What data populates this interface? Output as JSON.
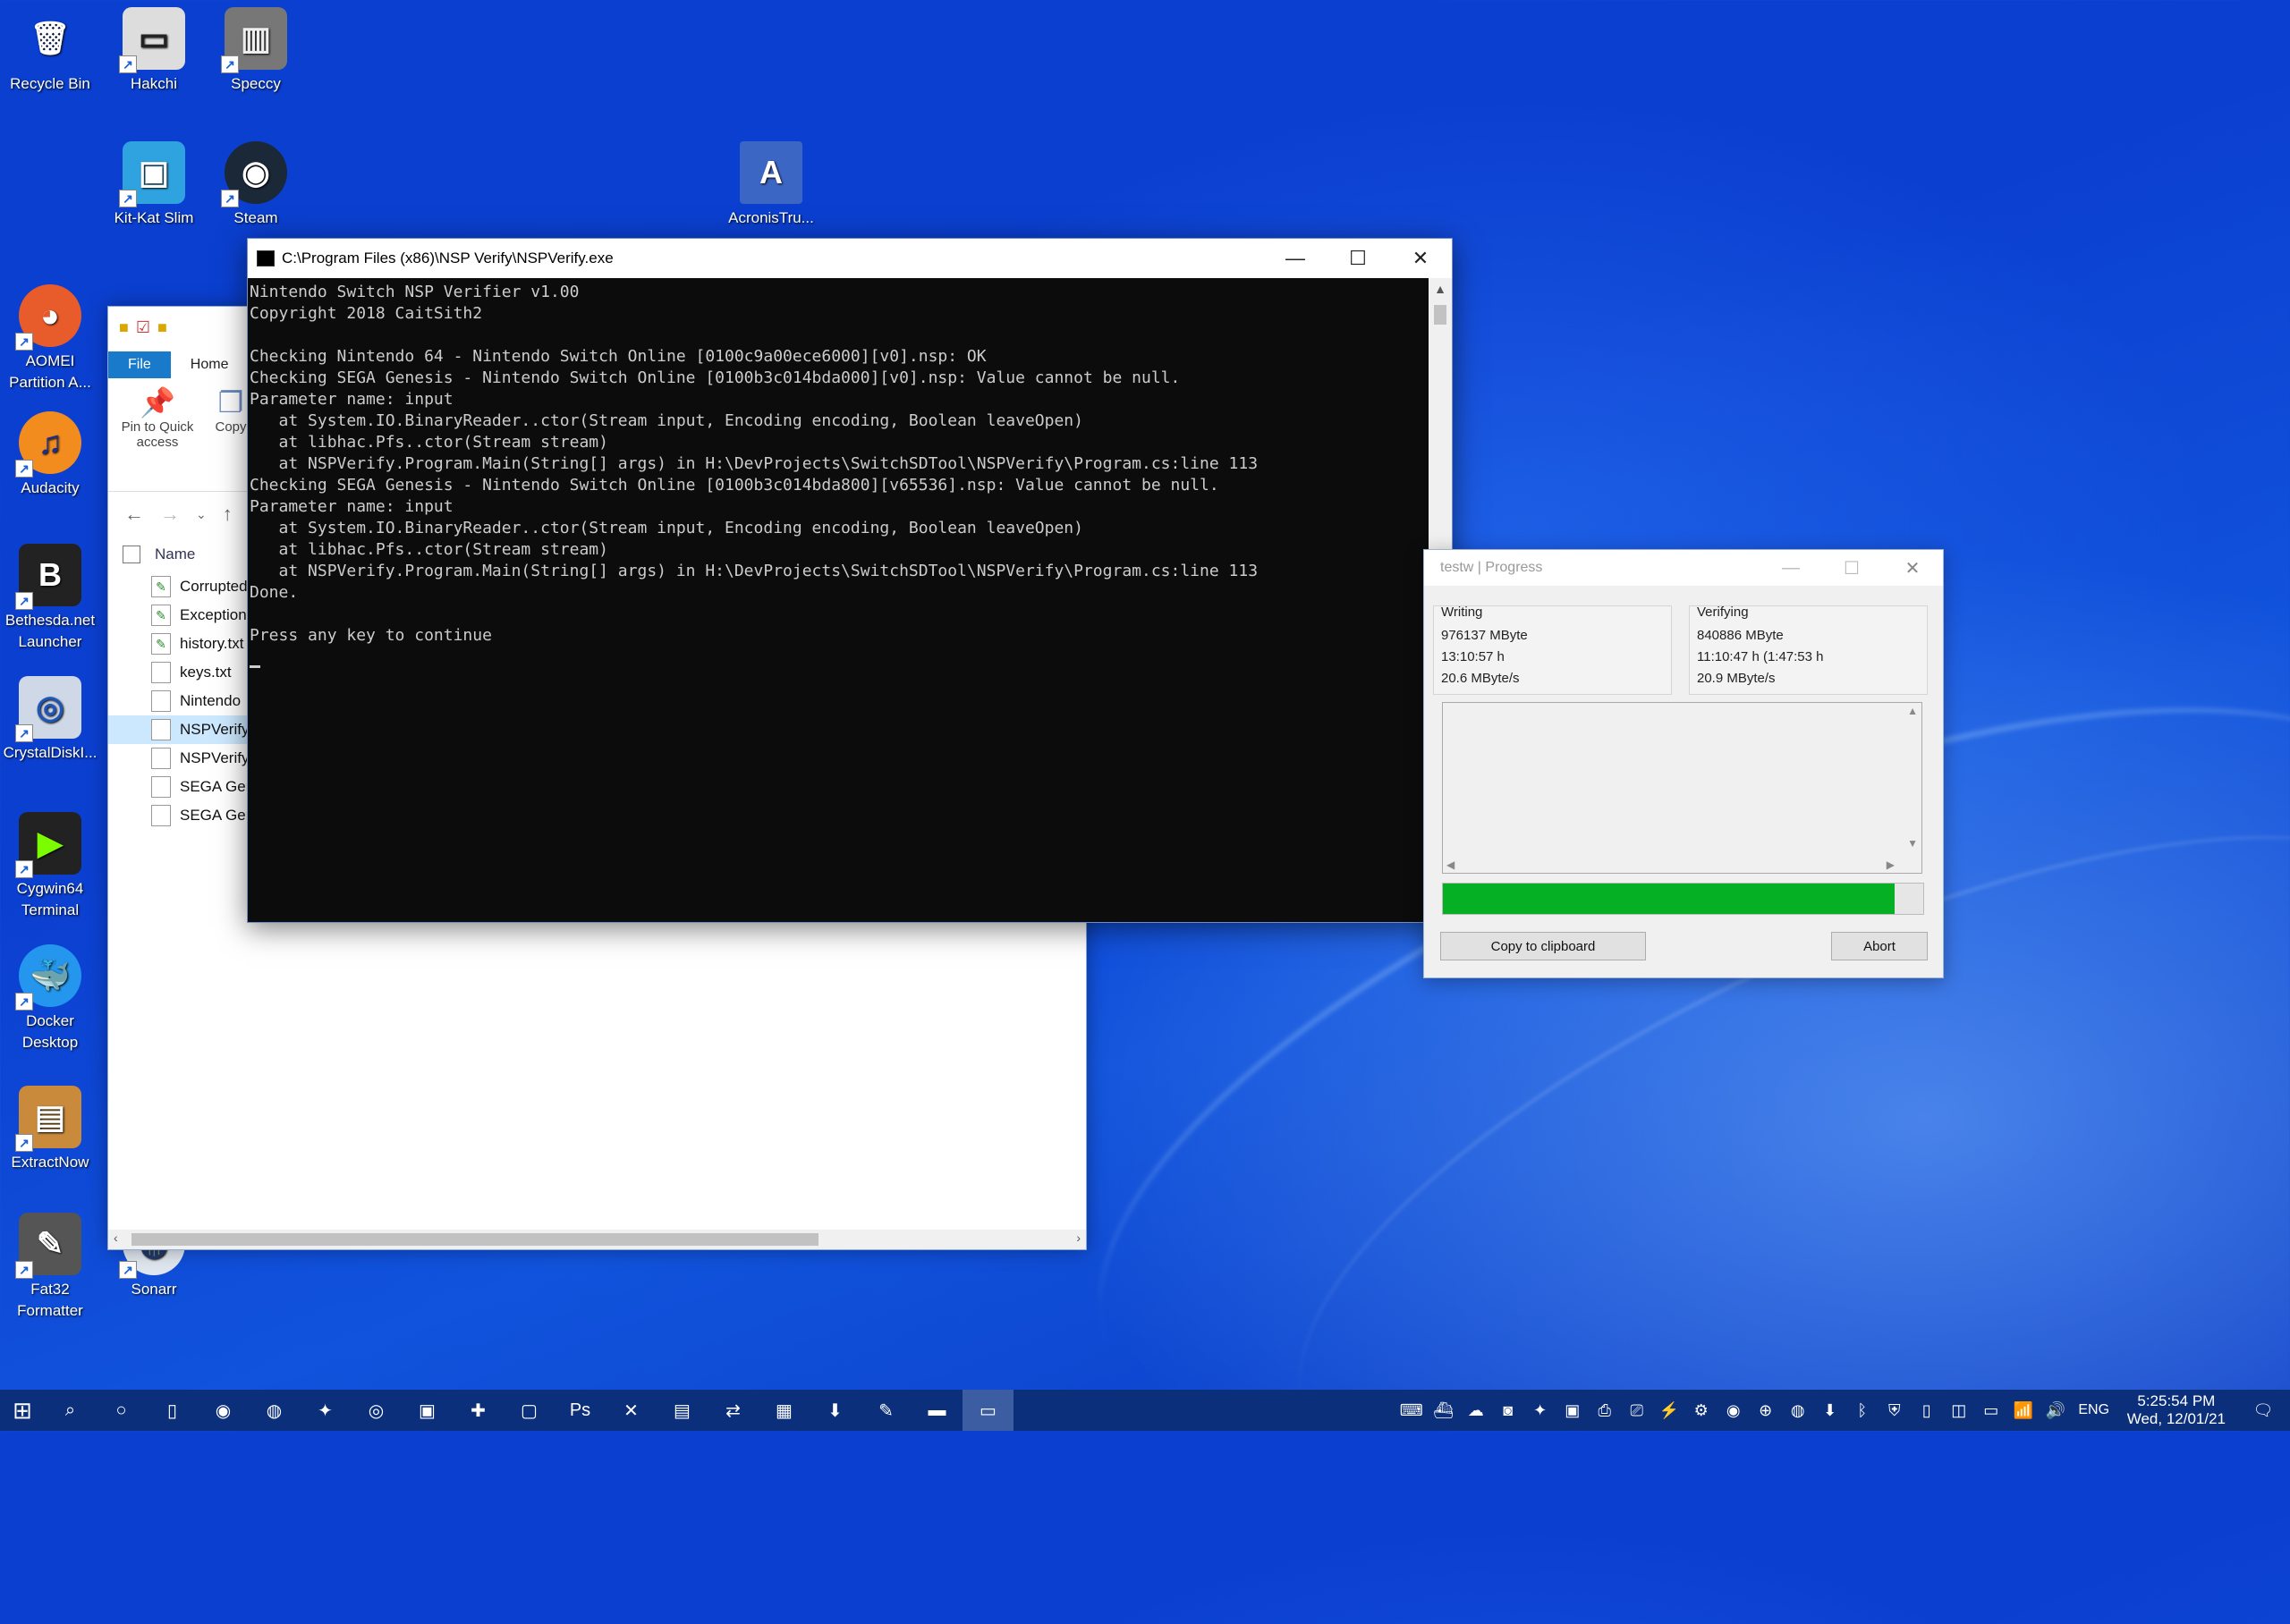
{
  "desktop": {
    "icons": [
      {
        "label": "Recycle Bin",
        "glyph": "🗑"
      },
      {
        "label": "Hakchi",
        "glyph": "▭"
      },
      {
        "label": "Speccy",
        "glyph": "▥"
      },
      {
        "label": "Kit-Kat Slim",
        "glyph": "▣"
      },
      {
        "label": "Steam",
        "glyph": "◉"
      },
      {
        "label": "AcronisTru...",
        "glyph": "A"
      },
      {
        "label": "AOMEI Partition A...",
        "glyph": "◕"
      },
      {
        "label": "Audacity",
        "glyph": "♫"
      },
      {
        "label": "Bethesda.net Launcher",
        "glyph": "B"
      },
      {
        "label": "CrystalDiskI...",
        "glyph": "◎"
      },
      {
        "label": "Cygwin64 Terminal",
        "glyph": "▶"
      },
      {
        "label": "Docker Desktop",
        "glyph": "🐳"
      },
      {
        "label": "ExtractNow",
        "glyph": "▤"
      },
      {
        "label": "Fat32 Formatter",
        "glyph": "✎"
      },
      {
        "label": "Sonarr",
        "glyph": "◍"
      }
    ]
  },
  "explorer": {
    "tabs": [
      "File",
      "Home"
    ],
    "ribbon": [
      {
        "label": "Pin to Quick access",
        "icon": "pin-icon"
      },
      {
        "label": "Copy",
        "icon": "copy-icon"
      }
    ],
    "column_name": "Name",
    "files": [
      "Corrupted",
      "Exception",
      "history.txt",
      "keys.txt",
      "Nintendo",
      "NSPVerify",
      "NSPVerify",
      "SEGA Gen",
      "SEGA Gen"
    ]
  },
  "console": {
    "title": "C:\\Program Files (x86)\\NSP Verify\\NSPVerify.exe",
    "output": "Nintendo Switch NSP Verifier v1.00\nCopyright 2018 CaitSith2\n\nChecking Nintendo 64 - Nintendo Switch Online [0100c9a00ece6000][v0].nsp: OK\nChecking SEGA Genesis - Nintendo Switch Online [0100b3c014bda000][v0].nsp: Value cannot be null.\nParameter name: input\n   at System.IO.BinaryReader..ctor(Stream input, Encoding encoding, Boolean leaveOpen)\n   at libhac.Pfs..ctor(Stream stream)\n   at NSPVerify.Program.Main(String[] args) in H:\\DevProjects\\SwitchSDTool\\NSPVerify\\Program.cs:line 113\nChecking SEGA Genesis - Nintendo Switch Online [0100b3c014bda800][v65536].nsp: Value cannot be null.\nParameter name: input\n   at System.IO.BinaryReader..ctor(Stream input, Encoding encoding, Boolean leaveOpen)\n   at libhac.Pfs..ctor(Stream stream)\n   at NSPVerify.Program.Main(String[] args) in H:\\DevProjects\\SwitchSDTool\\NSPVerify\\Program.cs:line 113\nDone.\n\nPress any key to continue"
  },
  "progress_window": {
    "title": "testw | Progress",
    "writing": {
      "label": "Writing",
      "size": "976137 MByte",
      "time": "13:10:57 h",
      "speed": "20.6 MByte/s"
    },
    "verifying": {
      "label": "Verifying",
      "size": "840886 MByte",
      "time": "11:10:47 h (1:47:53 h",
      "speed": "20.9 MByte/s"
    },
    "progress_percent": 94,
    "copy_button": "Copy to clipboard",
    "abort_button": "Abort",
    "accent_color": "#06b025"
  },
  "taskbar": {
    "apps": [
      "firefox-icon",
      "ie-icon",
      "hakchi-icon",
      "browser-icon",
      "qbittorrent-icon",
      "filezilla-icon",
      "window-icon",
      "photoshop-icon",
      "explorer-x-icon",
      "excel-icon",
      "network-icon",
      "calculator-icon",
      "download-icon",
      "notepad-icon",
      "folder-icon",
      "console-icon"
    ],
    "language": "ENG",
    "time": "5:25:54 PM",
    "date": "Wed, 12/01/21"
  }
}
